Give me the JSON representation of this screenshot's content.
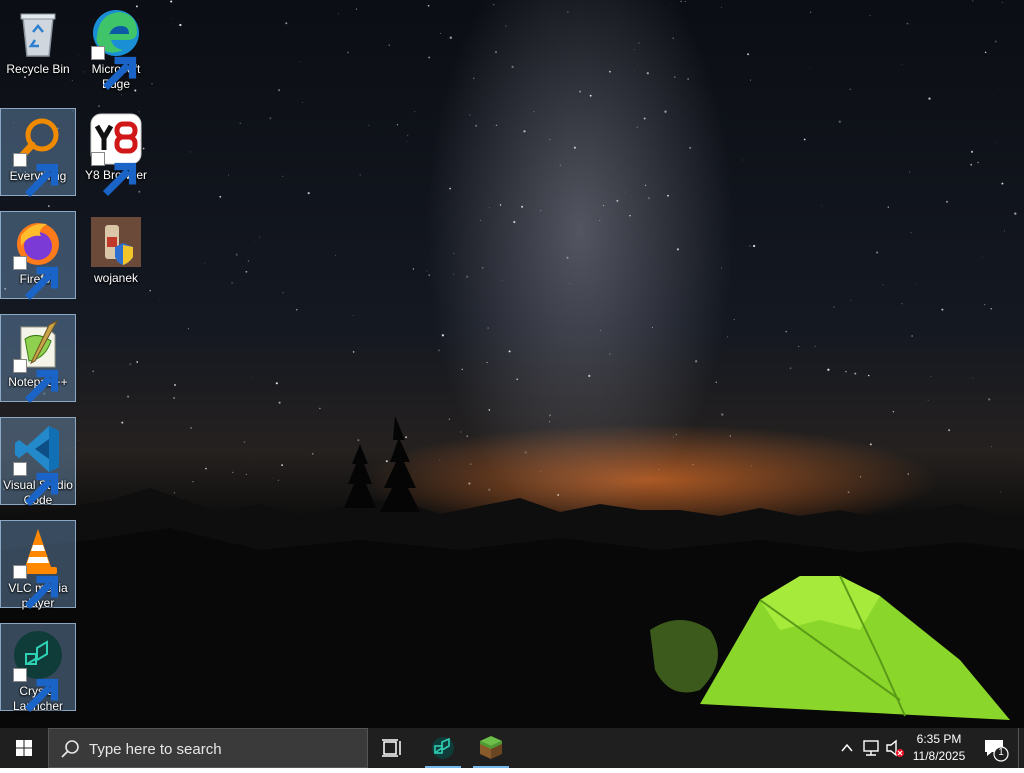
{
  "desktop": {
    "icons": [
      {
        "name": "recycle-bin",
        "label": "Recycle Bin"
      },
      {
        "name": "microsoft-edge",
        "label": "Microsoft Edge"
      },
      {
        "name": "everything",
        "label": "Everything"
      },
      {
        "name": "y8-browser",
        "label": "Y8 Browser"
      },
      {
        "name": "firefox",
        "label": "Firefox"
      },
      {
        "name": "wojanek",
        "label": "wojanek"
      },
      {
        "name": "notepad-plus-plus",
        "label": "Notepad++"
      },
      {
        "name": "visual-studio-code",
        "label": "Visual Studio Code"
      },
      {
        "name": "vlc-media-player",
        "label": "VLC media player"
      },
      {
        "name": "crystal-launcher",
        "label": "Crystal Launcher"
      }
    ]
  },
  "taskbar": {
    "search_placeholder": "Type here to search",
    "pinned": [
      "task-view-icon",
      "crystal-launcher-icon",
      "minecraft-icon"
    ],
    "tray": {
      "time": "6:35 PM",
      "date": "11/8/2025",
      "notification_count": "1",
      "icons": [
        "chevron-up-icon",
        "network-icon",
        "volume-muted-icon",
        "action-center-icon"
      ]
    }
  },
  "colors": {
    "taskbar_bg": "#1f1f1f",
    "search_bg": "#3a3a3a",
    "active_indicator": "#76b9ed",
    "selection": "#6e96be"
  }
}
